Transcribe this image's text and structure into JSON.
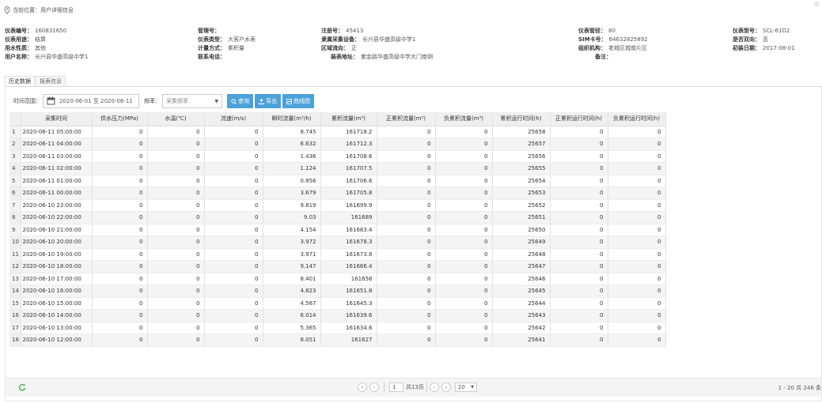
{
  "breadcrumb": {
    "label": "当前位置：用户详细信息"
  },
  "info": {
    "row1": [
      {
        "label": "仪表编号：",
        "value": "160831650"
      },
      {
        "label": "管理号：",
        "value": ""
      },
      {
        "label": "注册号：",
        "value": "45413"
      },
      {
        "label": "仪表管径：",
        "value": "80"
      },
      {
        "label": "仪表型号：",
        "value": "SCL-61D2"
      }
    ],
    "row2": [
      {
        "label": "仪表用途：",
        "value": "结算"
      },
      {
        "label": "仪表类型：",
        "value": "大客户水表"
      },
      {
        "label": "隶属采集设备：",
        "value": "长兴县华盛高级中学1"
      },
      {
        "label": "SIM卡号：",
        "value": "64632825892"
      },
      {
        "label": "是否双向：",
        "value": "否"
      }
    ],
    "row3": [
      {
        "label": "用水性质：",
        "value": "其他"
      },
      {
        "label": "计量方式：",
        "value": "累积量"
      },
      {
        "label": "区域流向：",
        "value": "正"
      },
      {
        "label": "组织机构：",
        "value": "老城区城南片区"
      },
      {
        "label": "初装日期：",
        "value": "2017-08-01"
      }
    ],
    "row4": [
      {
        "label": "用户名称：",
        "value": "长兴县华盛高级中学1"
      },
      {
        "label": "联系电话：",
        "value": ""
      },
      {
        "label": "装表地址：",
        "value": "紫金路华盛高级中学大门南侧"
      },
      {
        "label": "备注：",
        "value": ""
      }
    ]
  },
  "tabs": [
    "历史数据",
    "报表信息"
  ],
  "toolbar": {
    "time_label": "时间范围：",
    "date_range": "2020-06-01 至 2020-06-11",
    "freq_label": "频率：",
    "freq_value": "采集频率",
    "query": "查询",
    "export": "导出",
    "curve": "曲线图"
  },
  "table": {
    "headers": [
      "采集时间",
      "供水压力(MPa)",
      "水温(℃)",
      "流速(m/s)",
      "瞬时流量(m³/h)",
      "累积流量(m³)",
      "正累积流量(m³)",
      "负累积流量(m³)",
      "累积运行时间(h)",
      "正累积运行时间(h)",
      "负累积运行时间(h)"
    ],
    "rows": [
      [
        "1",
        "2020-06-11 05:00:00",
        "0",
        "0",
        "0",
        "8.745",
        "161718.2",
        "0",
        "0",
        "25658",
        "0",
        "0"
      ],
      [
        "2",
        "2020-06-11 04:00:00",
        "0",
        "0",
        "0",
        "6.632",
        "161712.3",
        "0",
        "0",
        "25657",
        "0",
        "0"
      ],
      [
        "3",
        "2020-06-11 03:00:00",
        "0",
        "0",
        "0",
        "1.436",
        "161708.6",
        "0",
        "0",
        "25656",
        "0",
        "0"
      ],
      [
        "4",
        "2020-06-11 02:00:00",
        "0",
        "0",
        "0",
        "1.124",
        "161707.5",
        "0",
        "0",
        "25655",
        "0",
        "0"
      ],
      [
        "5",
        "2020-06-11 01:00:00",
        "0",
        "0",
        "0",
        "0.856",
        "161706.6",
        "0",
        "0",
        "25654",
        "0",
        "0"
      ],
      [
        "6",
        "2020-06-11 00:00:00",
        "0",
        "0",
        "0",
        "3.679",
        "161705.8",
        "0",
        "0",
        "25653",
        "0",
        "0"
      ],
      [
        "7",
        "2020-06-10 23:00:00",
        "0",
        "0",
        "0",
        "9.819",
        "161699.9",
        "0",
        "0",
        "25652",
        "0",
        "0"
      ],
      [
        "8",
        "2020-06-10 22:00:00",
        "0",
        "0",
        "0",
        "9.03",
        "161689",
        "0",
        "0",
        "25651",
        "0",
        "0"
      ],
      [
        "9",
        "2020-06-10 21:00:00",
        "0",
        "0",
        "0",
        "4.154",
        "161683.4",
        "0",
        "0",
        "25650",
        "0",
        "0"
      ],
      [
        "10",
        "2020-06-10 20:00:00",
        "0",
        "0",
        "0",
        "3.972",
        "161678.3",
        "0",
        "0",
        "25649",
        "0",
        "0"
      ],
      [
        "11",
        "2020-06-10 19:00:00",
        "0",
        "0",
        "0",
        "3.971",
        "161673.8",
        "0",
        "0",
        "25648",
        "0",
        "0"
      ],
      [
        "12",
        "2020-06-10 18:00:00",
        "0",
        "0",
        "0",
        "9.147",
        "161666.4",
        "0",
        "0",
        "25647",
        "0",
        "0"
      ],
      [
        "13",
        "2020-06-10 17:00:00",
        "0",
        "0",
        "0",
        "8.401",
        "161658",
        "0",
        "0",
        "25646",
        "0",
        "0"
      ],
      [
        "14",
        "2020-06-10 16:00:00",
        "0",
        "0",
        "0",
        "4.823",
        "161651.8",
        "0",
        "0",
        "25645",
        "0",
        "0"
      ],
      [
        "15",
        "2020-06-10 15:00:00",
        "0",
        "0",
        "0",
        "4.567",
        "161645.3",
        "0",
        "0",
        "25644",
        "0",
        "0"
      ],
      [
        "16",
        "2020-06-10 14:00:00",
        "0",
        "0",
        "0",
        "6.014",
        "161639.6",
        "0",
        "0",
        "25643",
        "0",
        "0"
      ],
      [
        "17",
        "2020-06-10 13:00:00",
        "0",
        "0",
        "0",
        "5.365",
        "161634.6",
        "0",
        "0",
        "25642",
        "0",
        "0"
      ],
      [
        "18",
        "2020-06-10 12:00:00",
        "0",
        "0",
        "0",
        "8.051",
        "161627",
        "0",
        "0",
        "25641",
        "0",
        "0"
      ]
    ]
  },
  "pager": {
    "page_input": "1",
    "total_pages": "共13页",
    "page_size": "20",
    "summary": "1 - 20  共 246 条"
  },
  "colors": {
    "accent": "#4da1d9",
    "refresh": "#4caf50"
  }
}
